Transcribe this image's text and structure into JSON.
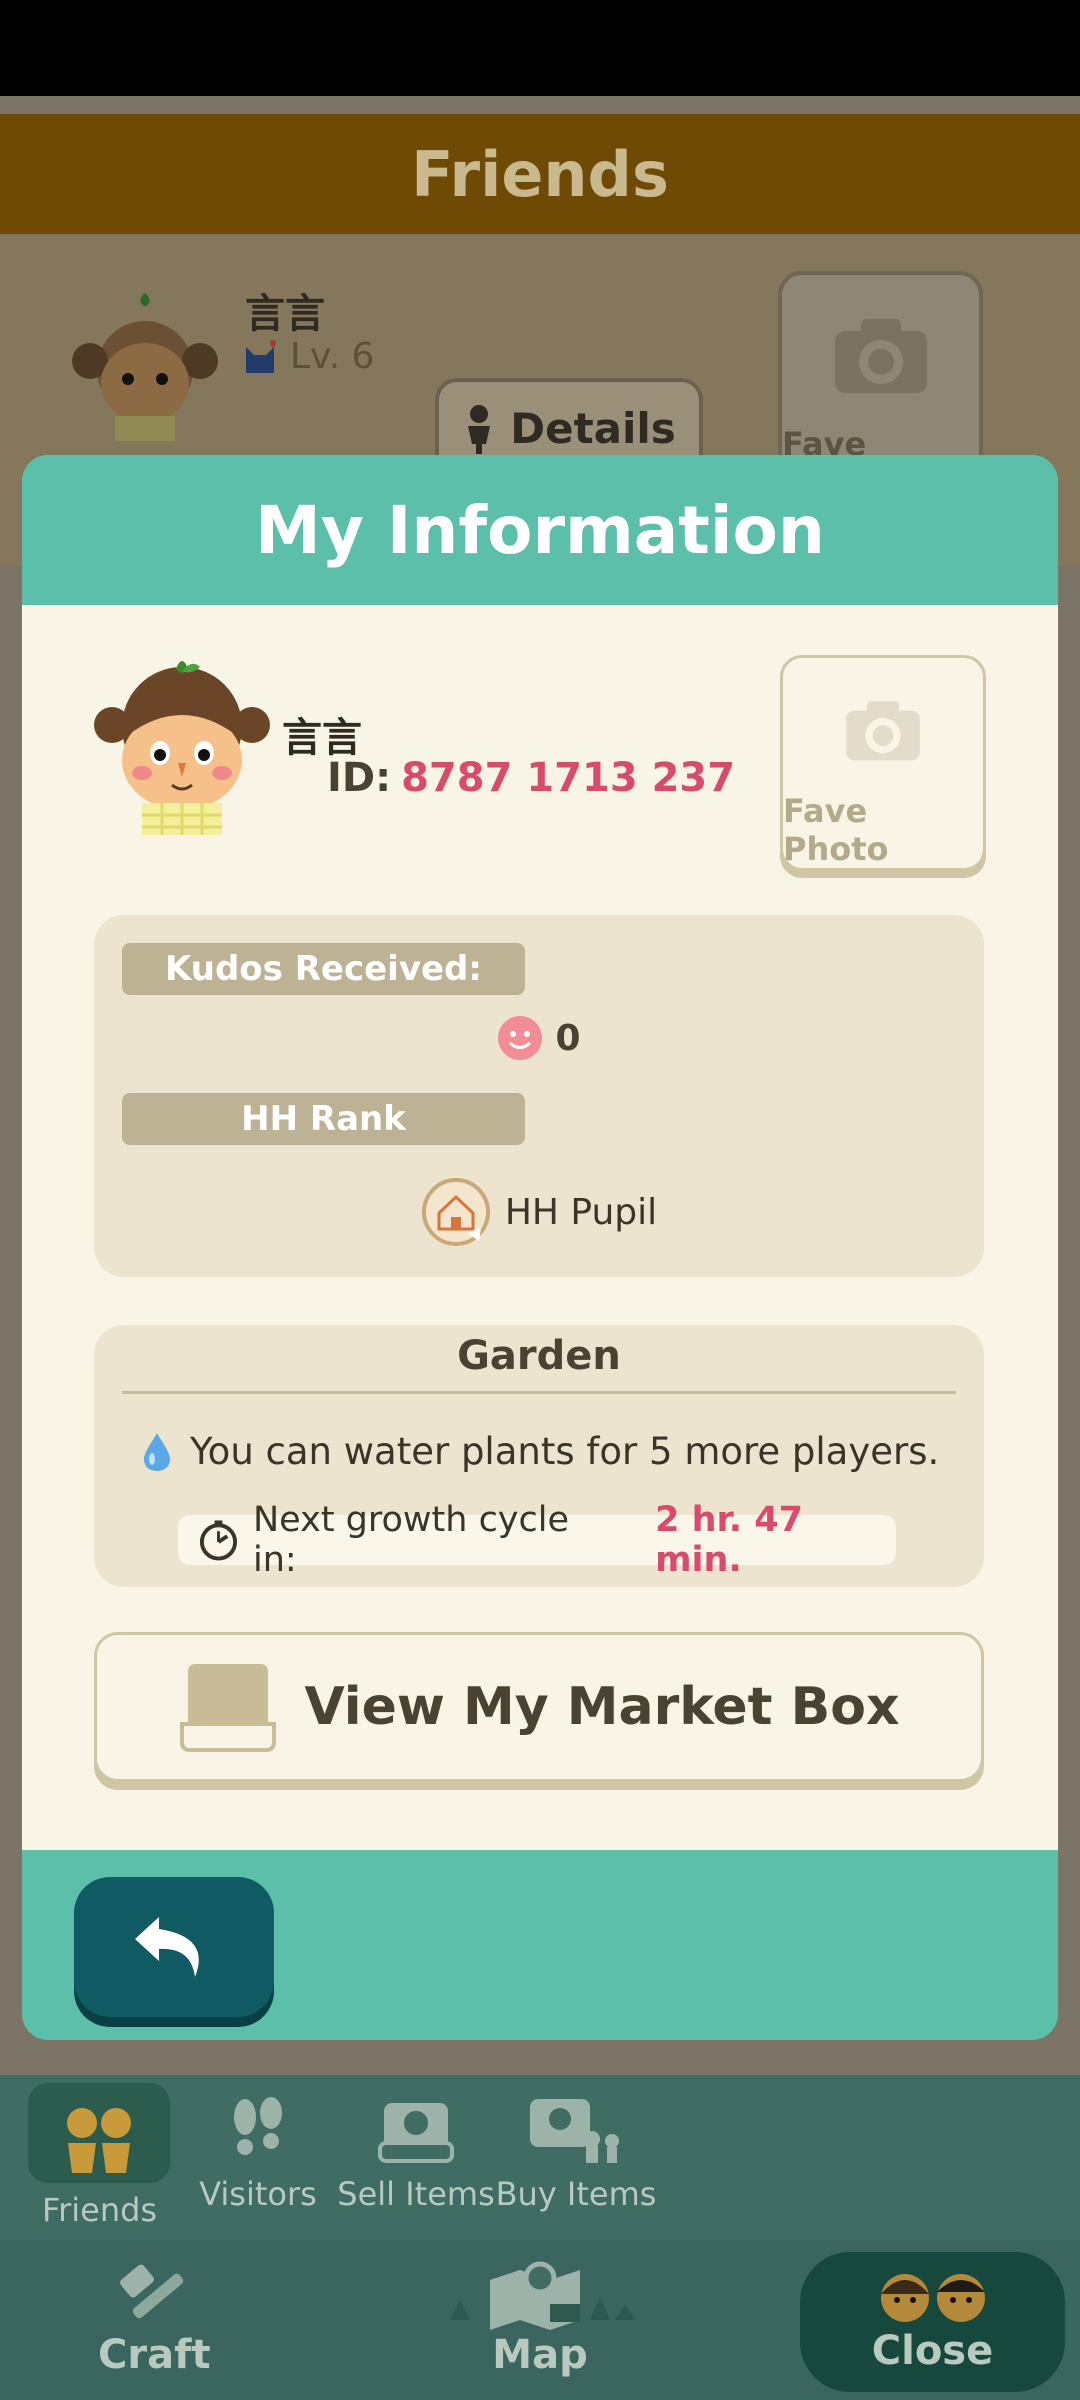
{
  "background": {
    "header_title": "Friends",
    "friend_name": "言言",
    "friend_level": "Lv. 6",
    "details_label": "Details",
    "fave_photo_label": "Fave Photo"
  },
  "modal": {
    "title": "My Information",
    "user": {
      "name": "言言",
      "id_label": "ID:",
      "id_value": "8787 1713 237"
    },
    "fave_photo_label": "Fave Photo",
    "kudos": {
      "label": "Kudos Received:",
      "value": "0"
    },
    "rank": {
      "label": "HH Rank",
      "value": "HH Pupil"
    },
    "garden": {
      "title": "Garden",
      "water_text": "You can water plants for 5 more players.",
      "growth_label": "Next growth cycle in:",
      "growth_value": "2 hr. 47 min."
    },
    "market_button_label": "View My Market Box"
  },
  "nav": {
    "tabs": [
      {
        "label": "Friends",
        "icon": "friends-icon",
        "active": true
      },
      {
        "label": "Visitors",
        "icon": "footprints-icon",
        "active": false
      },
      {
        "label": "Sell Items",
        "icon": "sell-box-icon",
        "active": false
      },
      {
        "label": "Buy Items",
        "icon": "buy-box-icon",
        "active": false
      }
    ],
    "bottom": {
      "craft": "Craft",
      "map": "Map",
      "close": "Close"
    }
  },
  "colors": {
    "teal": "#5cbfa9",
    "accent_pink": "#d94b6c",
    "dark_teal_button": "#0f5a63"
  }
}
